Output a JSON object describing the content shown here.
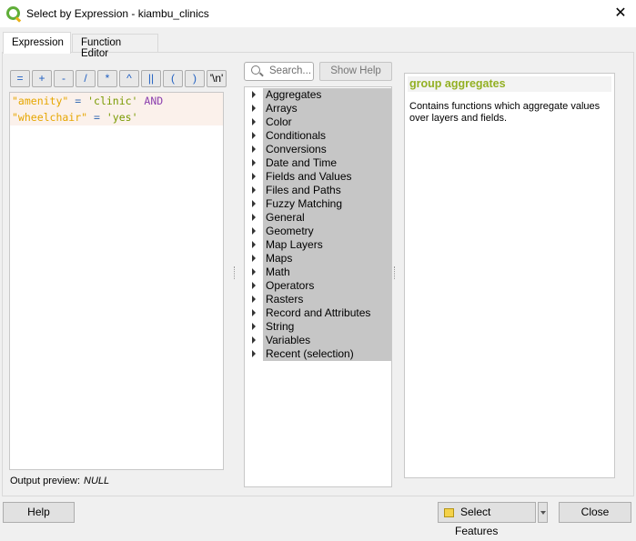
{
  "window": {
    "title": "Select by Expression - kiambu_clinics",
    "close_icon": "close-icon"
  },
  "tabs": [
    {
      "label": "Expression",
      "active": true
    },
    {
      "label": "Function Editor",
      "active": false
    }
  ],
  "operators": [
    "=",
    "+",
    "-",
    "/",
    "*",
    "^",
    "||",
    "(",
    ")",
    "'\\n'"
  ],
  "editor": {
    "line1": {
      "field": "\"amenity\"",
      "op": " = ",
      "value": "'clinic'",
      "kw": " AND"
    },
    "line2": {
      "field": "\"wheelchair\"",
      "op": " = ",
      "value": "'yes'"
    }
  },
  "preview": {
    "label": "Output preview:",
    "value": "NULL"
  },
  "search": {
    "placeholder": "Search..."
  },
  "show_help": "Show Help",
  "tree": [
    "Aggregates",
    "Arrays",
    "Color",
    "Conditionals",
    "Conversions",
    "Date and Time",
    "Fields and Values",
    "Files and Paths",
    "Fuzzy Matching",
    "General",
    "Geometry",
    "Map Layers",
    "Maps",
    "Math",
    "Operators",
    "Rasters",
    "Record and Attributes",
    "String",
    "Variables",
    "Recent (selection)"
  ],
  "help": {
    "title": "group aggregates",
    "body": "Contains functions which aggregate values over layers and fields.",
    "title_color": "#93b023"
  },
  "buttons": {
    "help": "Help",
    "select": "Select Features",
    "close": "Close"
  }
}
